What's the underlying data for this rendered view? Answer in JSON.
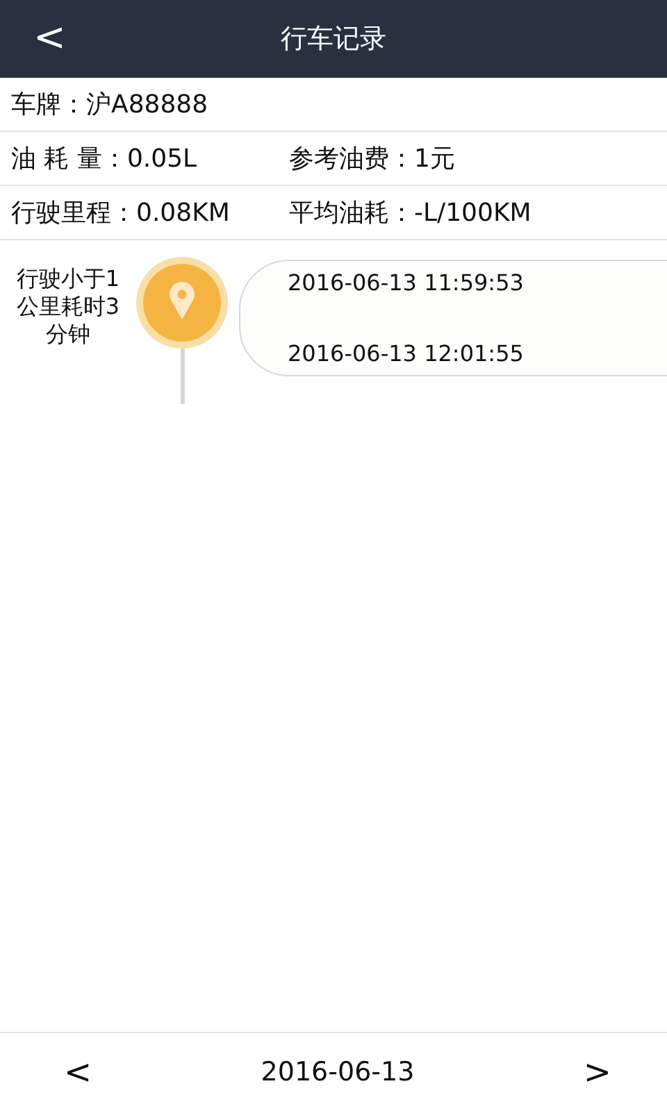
{
  "header": {
    "back": "<",
    "title": "行车记录"
  },
  "info_rows": [
    [
      "车牌：沪A88888"
    ],
    [
      "油 耗 量：0.05L",
      "参考油费：1元"
    ],
    [
      "行驶里程：0.08KM",
      "平均油耗：-L/100KM"
    ]
  ],
  "trips": [
    {
      "summary": "行驶小于1公里耗时3分钟",
      "start_time": "2016-06-13 11:59:53",
      "end_time": "2016-06-13 12:01:55"
    }
  ],
  "date_nav": {
    "prev": "<",
    "date": "2016-06-13",
    "next": ">"
  }
}
